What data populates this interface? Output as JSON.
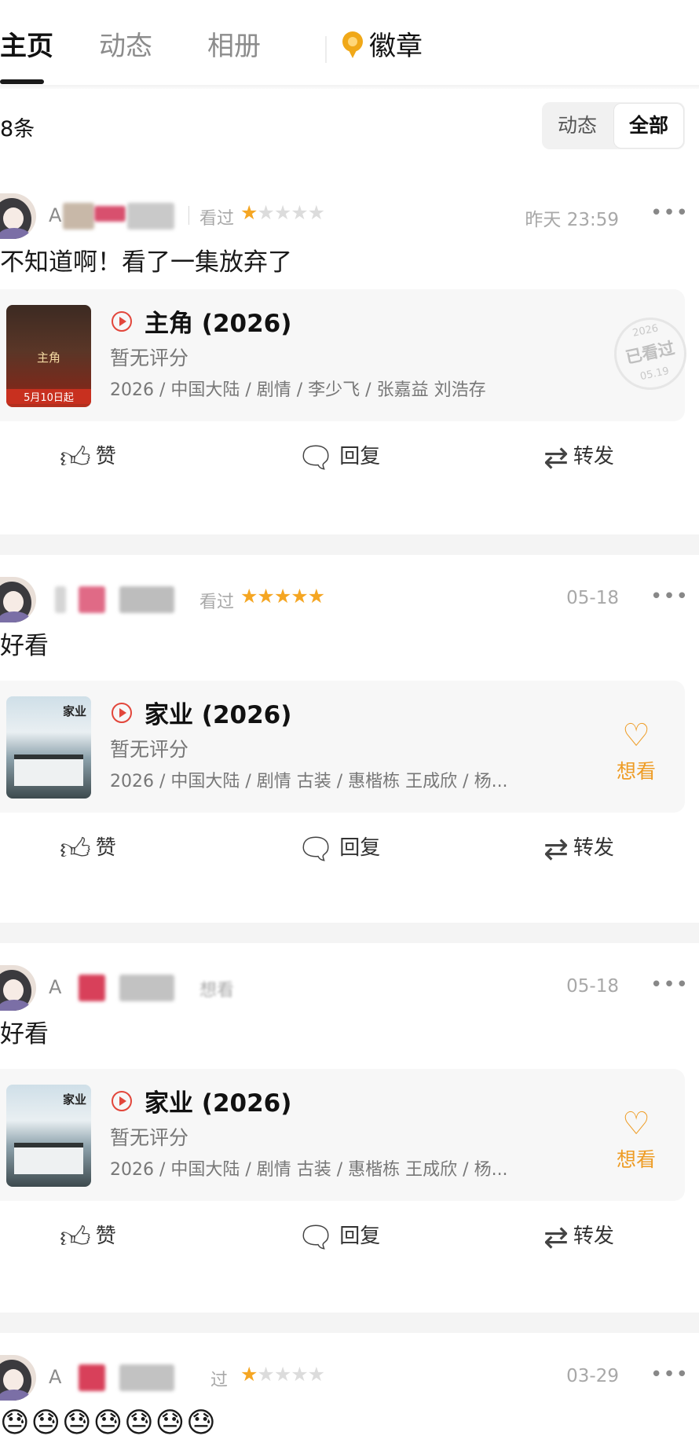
{
  "tabs": {
    "items": [
      {
        "label": "主页",
        "active": true
      },
      {
        "label": "动态",
        "active": false
      },
      {
        "label": "相册",
        "active": false
      },
      {
        "label": "徽章",
        "icon": "medal-icon",
        "active": false
      }
    ]
  },
  "filter": {
    "count_label": "8条",
    "options": [
      {
        "label": "动态",
        "selected": false
      },
      {
        "label": "全部",
        "selected": true
      }
    ]
  },
  "colors": {
    "accent_orange": "#f5a623",
    "want_orange": "#ee9c25",
    "play_red": "#e2463b"
  },
  "posts": [
    {
      "user_prefix": "A",
      "rating_text": "看过",
      "stars": 1,
      "time": "昨天 23:59",
      "text": "不知道啊！看了一集放弃了",
      "movie": {
        "title": "主角 (2026)",
        "score": "暂无评分",
        "info": "2026 / 中国大陆 / 剧情 / 李少飞 / 张嘉益 刘浩存",
        "poster_title": "主角",
        "poster_date": "5月10日起",
        "stamp": {
          "year": "2026",
          "text": "已看过",
          "date": "05.19"
        }
      },
      "actions": {
        "like": "赞",
        "reply": "回复",
        "share": "转发"
      }
    },
    {
      "user_prefix": "",
      "rating_text": "看过",
      "stars": 5,
      "time": "05-18",
      "text": "好看",
      "movie": {
        "title": "家业 (2026)",
        "score": "暂无评分",
        "info": "2026 / 中国大陆 / 剧情 古装 / 惠楷栋 王成欣 / 杨...",
        "poster_title": "家业",
        "want_label": "想看"
      },
      "actions": {
        "like": "赞",
        "reply": "回复",
        "share": "转发"
      }
    },
    {
      "user_prefix": "A",
      "rating_text": "想看",
      "time": "05-18",
      "text": "好看",
      "movie": {
        "title": "家业 (2026)",
        "score": "暂无评分",
        "info": "2026 / 中国大陆 / 剧情 古装 / 惠楷栋 王成欣 / 杨...",
        "poster_title": "家业",
        "want_label": "想看"
      },
      "actions": {
        "like": "赞",
        "reply": "回复",
        "share": "转发"
      }
    },
    {
      "user_prefix": "A",
      "rating_text": "过",
      "stars": 1,
      "time": "03-29",
      "text": "😓😓😓😓😓😓😓"
    }
  ]
}
